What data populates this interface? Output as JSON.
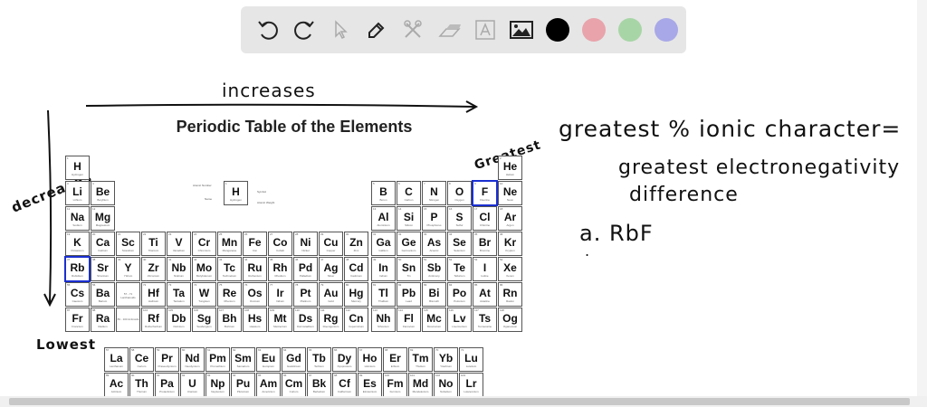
{
  "toolbar": {
    "tools": [
      {
        "name": "undo",
        "enabled": true
      },
      {
        "name": "redo",
        "enabled": true
      },
      {
        "name": "select",
        "enabled": false
      },
      {
        "name": "pen",
        "enabled": true
      },
      {
        "name": "tools",
        "enabled": false
      },
      {
        "name": "eraser",
        "enabled": false
      },
      {
        "name": "text",
        "enabled": false
      },
      {
        "name": "image",
        "enabled": true
      }
    ],
    "colors": [
      "#000000",
      "#e8a3ab",
      "#a8d5a6",
      "#a8a8e8"
    ]
  },
  "table": {
    "title": "Periodic Table of the Elements",
    "legend": {
      "symbol": "H",
      "name": "Hydrogen",
      "number": "1",
      "labels": {
        "atomic_number": "Atomic Number",
        "name": "Name",
        "symbol": "Symbol",
        "atomic_weight": "Atomic Weight"
      }
    },
    "lanthanoid_placeholder": "57 - 71 Lanthanoids",
    "actinoid_placeholder": "89 - 103 Actinoids",
    "highlighted": [
      "Rb",
      "F"
    ],
    "main": [
      [
        "H",
        1,
        "Hydrogen",
        1,
        1
      ],
      [
        "He",
        2,
        "Helium",
        1,
        18
      ],
      [
        "Li",
        3,
        "Lithium",
        2,
        1
      ],
      [
        "Be",
        4,
        "Beryllium",
        2,
        2
      ],
      [
        "B",
        5,
        "Boron",
        2,
        13
      ],
      [
        "C",
        6,
        "Carbon",
        2,
        14
      ],
      [
        "N",
        7,
        "Nitrogen",
        2,
        15
      ],
      [
        "O",
        8,
        "Oxygen",
        2,
        16
      ],
      [
        "F",
        9,
        "Fluorine",
        2,
        17
      ],
      [
        "Ne",
        10,
        "Neon",
        2,
        18
      ],
      [
        "Na",
        11,
        "Sodium",
        3,
        1
      ],
      [
        "Mg",
        12,
        "Magnesium",
        3,
        2
      ],
      [
        "Al",
        13,
        "Aluminium",
        3,
        13
      ],
      [
        "Si",
        14,
        "Silicon",
        3,
        14
      ],
      [
        "P",
        15,
        "Phosphorus",
        3,
        15
      ],
      [
        "S",
        16,
        "Sulfur",
        3,
        16
      ],
      [
        "Cl",
        17,
        "Chlorine",
        3,
        17
      ],
      [
        "Ar",
        18,
        "Argon",
        3,
        18
      ],
      [
        "K",
        19,
        "Potassium",
        4,
        1
      ],
      [
        "Ca",
        20,
        "Calcium",
        4,
        2
      ],
      [
        "Sc",
        21,
        "Scandium",
        4,
        3
      ],
      [
        "Ti",
        22,
        "Titanium",
        4,
        4
      ],
      [
        "V",
        23,
        "Vanadium",
        4,
        5
      ],
      [
        "Cr",
        24,
        "Chromium",
        4,
        6
      ],
      [
        "Mn",
        25,
        "Manganese",
        4,
        7
      ],
      [
        "Fe",
        26,
        "Iron",
        4,
        8
      ],
      [
        "Co",
        27,
        "Cobalt",
        4,
        9
      ],
      [
        "Ni",
        28,
        "Nickel",
        4,
        10
      ],
      [
        "Cu",
        29,
        "Copper",
        4,
        11
      ],
      [
        "Zn",
        30,
        "Zinc",
        4,
        12
      ],
      [
        "Ga",
        31,
        "Gallium",
        4,
        13
      ],
      [
        "Ge",
        32,
        "Germanium",
        4,
        14
      ],
      [
        "As",
        33,
        "Arsenic",
        4,
        15
      ],
      [
        "Se",
        34,
        "Selenium",
        4,
        16
      ],
      [
        "Br",
        35,
        "Bromine",
        4,
        17
      ],
      [
        "Kr",
        36,
        "Krypton",
        4,
        18
      ],
      [
        "Rb",
        37,
        "Rubidium",
        5,
        1
      ],
      [
        "Sr",
        38,
        "Strontium",
        5,
        2
      ],
      [
        "Y",
        39,
        "Yttrium",
        5,
        3
      ],
      [
        "Zr",
        40,
        "Zirconium",
        5,
        4
      ],
      [
        "Nb",
        41,
        "Niobium",
        5,
        5
      ],
      [
        "Mo",
        42,
        "Molybdenum",
        5,
        6
      ],
      [
        "Tc",
        43,
        "Technetium",
        5,
        7
      ],
      [
        "Ru",
        44,
        "Ruthenium",
        5,
        8
      ],
      [
        "Rh",
        45,
        "Rhodium",
        5,
        9
      ],
      [
        "Pd",
        46,
        "Palladium",
        5,
        10
      ],
      [
        "Ag",
        47,
        "Silver",
        5,
        11
      ],
      [
        "Cd",
        48,
        "Cadmium",
        5,
        12
      ],
      [
        "In",
        49,
        "Indium",
        5,
        13
      ],
      [
        "Sn",
        50,
        "Tin",
        5,
        14
      ],
      [
        "Sb",
        51,
        "Antimony",
        5,
        15
      ],
      [
        "Te",
        52,
        "Tellurium",
        5,
        16
      ],
      [
        "I",
        53,
        "Iodine",
        5,
        17
      ],
      [
        "Xe",
        54,
        "Xenon",
        5,
        18
      ],
      [
        "Cs",
        55,
        "Caesium",
        6,
        1
      ],
      [
        "Ba",
        56,
        "Barium",
        6,
        2
      ],
      [
        "Hf",
        72,
        "Hafnium",
        6,
        4
      ],
      [
        "Ta",
        73,
        "Tantalum",
        6,
        5
      ],
      [
        "W",
        74,
        "Tungsten",
        6,
        6
      ],
      [
        "Re",
        75,
        "Rhenium",
        6,
        7
      ],
      [
        "Os",
        76,
        "Osmium",
        6,
        8
      ],
      [
        "Ir",
        77,
        "Iridium",
        6,
        9
      ],
      [
        "Pt",
        78,
        "Platinum",
        6,
        10
      ],
      [
        "Au",
        79,
        "Gold",
        6,
        11
      ],
      [
        "Hg",
        80,
        "Mercury",
        6,
        12
      ],
      [
        "Tl",
        81,
        "Thallium",
        6,
        13
      ],
      [
        "Pb",
        82,
        "Lead",
        6,
        14
      ],
      [
        "Bi",
        83,
        "Bismuth",
        6,
        15
      ],
      [
        "Po",
        84,
        "Polonium",
        6,
        16
      ],
      [
        "At",
        85,
        "Astatine",
        6,
        17
      ],
      [
        "Rn",
        86,
        "Radon",
        6,
        18
      ],
      [
        "Fr",
        87,
        "Francium",
        7,
        1
      ],
      [
        "Ra",
        88,
        "Radium",
        7,
        2
      ],
      [
        "Rf",
        104,
        "Rutherfordium",
        7,
        4
      ],
      [
        "Db",
        105,
        "Dubnium",
        7,
        5
      ],
      [
        "Sg",
        106,
        "Seaborgium",
        7,
        6
      ],
      [
        "Bh",
        107,
        "Bohrium",
        7,
        7
      ],
      [
        "Hs",
        108,
        "Hassium",
        7,
        8
      ],
      [
        "Mt",
        109,
        "Meitnerium",
        7,
        9
      ],
      [
        "Ds",
        110,
        "Darmstadtium",
        7,
        10
      ],
      [
        "Rg",
        111,
        "Roentgenium",
        7,
        11
      ],
      [
        "Cn",
        112,
        "Copernicium",
        7,
        12
      ],
      [
        "Nh",
        113,
        "Nihonium",
        7,
        13
      ],
      [
        "Fl",
        114,
        "Flerovium",
        7,
        14
      ],
      [
        "Mc",
        115,
        "Moscovium",
        7,
        15
      ],
      [
        "Lv",
        116,
        "Livermorium",
        7,
        16
      ],
      [
        "Ts",
        117,
        "Tennessine",
        7,
        17
      ],
      [
        "Og",
        118,
        "Oganesson",
        7,
        18
      ]
    ],
    "lanthanoids": [
      [
        "La",
        57,
        "Lanthanum"
      ],
      [
        "Ce",
        58,
        "Cerium"
      ],
      [
        "Pr",
        59,
        "Praseodymium"
      ],
      [
        "Nd",
        60,
        "Neodymium"
      ],
      [
        "Pm",
        61,
        "Promethium"
      ],
      [
        "Sm",
        62,
        "Samarium"
      ],
      [
        "Eu",
        63,
        "Europium"
      ],
      [
        "Gd",
        64,
        "Gadolinium"
      ],
      [
        "Tb",
        65,
        "Terbium"
      ],
      [
        "Dy",
        66,
        "Dysprosium"
      ],
      [
        "Ho",
        67,
        "Holmium"
      ],
      [
        "Er",
        68,
        "Erbium"
      ],
      [
        "Tm",
        69,
        "Thulium"
      ],
      [
        "Yb",
        70,
        "Ytterbium"
      ],
      [
        "Lu",
        71,
        "Lutetium"
      ]
    ],
    "actinoids": [
      [
        "Ac",
        89,
        "Actinium"
      ],
      [
        "Th",
        90,
        "Thorium"
      ],
      [
        "Pa",
        91,
        "Protactinium"
      ],
      [
        "U",
        92,
        "Uranium"
      ],
      [
        "Np",
        93,
        "Neptunium"
      ],
      [
        "Pu",
        94,
        "Plutonium"
      ],
      [
        "Am",
        95,
        "Americium"
      ],
      [
        "Cm",
        96,
        "Curium"
      ],
      [
        "Bk",
        97,
        "Berkelium"
      ],
      [
        "Cf",
        98,
        "Californium"
      ],
      [
        "Es",
        99,
        "Einsteinium"
      ],
      [
        "Fm",
        100,
        "Fermium"
      ],
      [
        "Md",
        101,
        "Mendelevium"
      ],
      [
        "No",
        102,
        "Nobelium"
      ],
      [
        "Lr",
        103,
        "Lawrencium"
      ]
    ]
  },
  "annotations": {
    "increases": "increases",
    "decreases": "decreases",
    "greatest": "Greatest",
    "lowest": "Lowest",
    "line1": "greatest % ionic character=",
    "line2": "greatest electronegativity",
    "line3": "difference",
    "answer": "a. RbF",
    "bullet": "."
  }
}
